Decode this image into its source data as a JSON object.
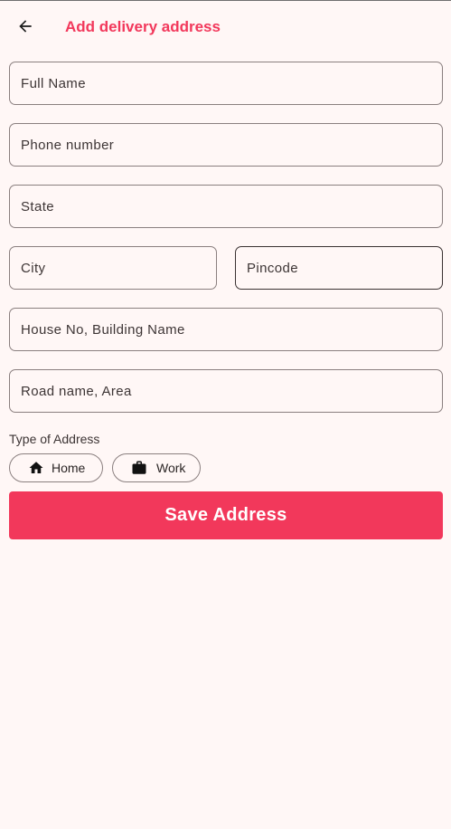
{
  "header": {
    "back_icon": "arrow-back-icon",
    "title": "Add delivery address"
  },
  "form": {
    "full_name": {
      "placeholder": "Full Name",
      "value": ""
    },
    "phone": {
      "placeholder": "Phone number",
      "value": ""
    },
    "state": {
      "placeholder": "State",
      "value": ""
    },
    "city": {
      "placeholder": "City",
      "value": ""
    },
    "pincode": {
      "placeholder": "Pincode",
      "value": ""
    },
    "house": {
      "placeholder": "House No, Building Name",
      "value": ""
    },
    "road": {
      "placeholder": "Road name, Area",
      "value": ""
    }
  },
  "address_type": {
    "label": "Type of Address",
    "options": [
      {
        "label": "Home",
        "icon": "home-icon"
      },
      {
        "label": "Work",
        "icon": "briefcase-icon"
      }
    ]
  },
  "save_button": {
    "label": "Save Address"
  },
  "colors": {
    "accent": "#f2385b",
    "background": "#fff7f6"
  }
}
